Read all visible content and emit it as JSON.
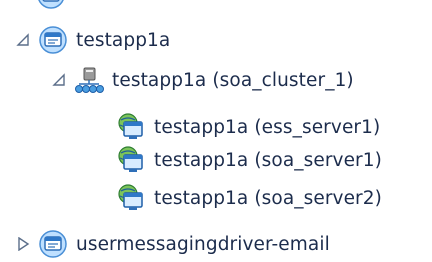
{
  "tree": {
    "nodes": [
      {
        "label": "testapp1a",
        "expanded": true,
        "icon": "application-icon"
      },
      {
        "label": "testapp1a (soa_cluster_1)",
        "expanded": true,
        "icon": "cluster-icon"
      },
      {
        "label": "testapp1a (ess_server1)",
        "icon": "server-instance-icon"
      },
      {
        "label": "testapp1a (soa_server1)",
        "icon": "server-instance-icon"
      },
      {
        "label": "testapp1a (soa_server2)",
        "icon": "server-instance-icon"
      },
      {
        "label": "usermessagingdriver-email",
        "expanded": false,
        "icon": "application-icon"
      }
    ]
  },
  "colors": {
    "text": "#1c2c4c",
    "expander": "#5b6e8a",
    "icon_blue": "#2f78c8",
    "icon_light": "#d8ecff",
    "globe_green": "#3aa84a"
  }
}
